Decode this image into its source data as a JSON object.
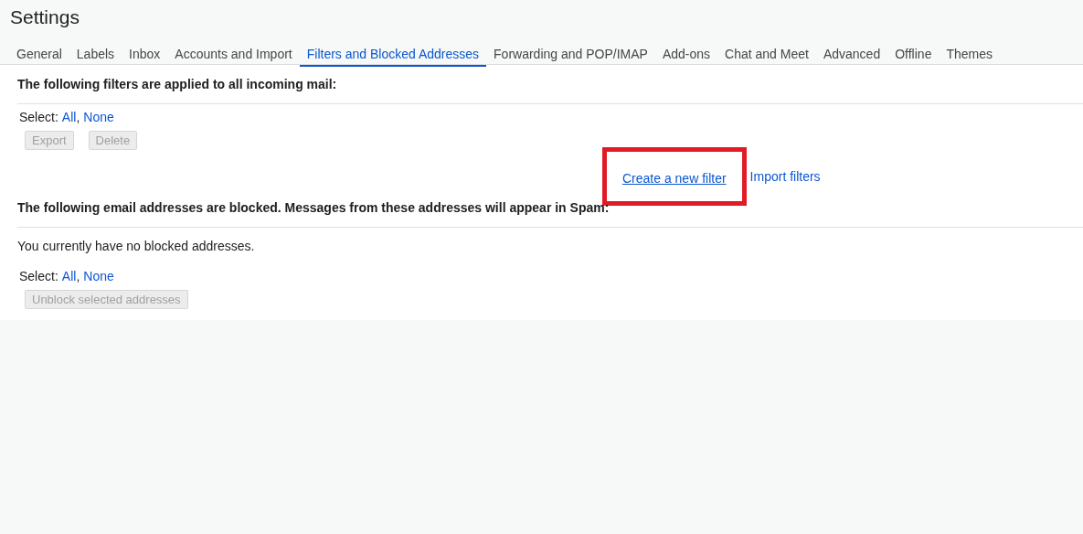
{
  "title": "Settings",
  "tabs": [
    {
      "label": "General",
      "selected": false
    },
    {
      "label": "Labels",
      "selected": false
    },
    {
      "label": "Inbox",
      "selected": false
    },
    {
      "label": "Accounts and Import",
      "selected": false
    },
    {
      "label": "Filters and Blocked Addresses",
      "selected": true
    },
    {
      "label": "Forwarding and POP/IMAP",
      "selected": false
    },
    {
      "label": "Add-ons",
      "selected": false
    },
    {
      "label": "Chat and Meet",
      "selected": false
    },
    {
      "label": "Advanced",
      "selected": false
    },
    {
      "label": "Offline",
      "selected": false
    },
    {
      "label": "Themes",
      "selected": false
    }
  ],
  "filters": {
    "heading": "The following filters are applied to all incoming mail:",
    "select": {
      "label": "Select:",
      "links": [
        "All",
        "None"
      ],
      "separator": ","
    },
    "buttons": [
      {
        "label": "Export",
        "disabled": true
      },
      {
        "label": "Delete",
        "disabled": true
      }
    ],
    "links": [
      {
        "label": "Create a new filter",
        "highlighted": true
      },
      {
        "label": "Import filters",
        "highlighted": false
      }
    ]
  },
  "blocked": {
    "heading": "The following email addresses are blocked. Messages from these addresses will appear in Spam:",
    "message": "You currently have no blocked addresses.",
    "select": {
      "label": "Select:",
      "links": [
        "All",
        "None"
      ],
      "separator": ","
    },
    "buttons": [
      {
        "label": "Unblock selected addresses",
        "disabled": true
      }
    ]
  }
}
